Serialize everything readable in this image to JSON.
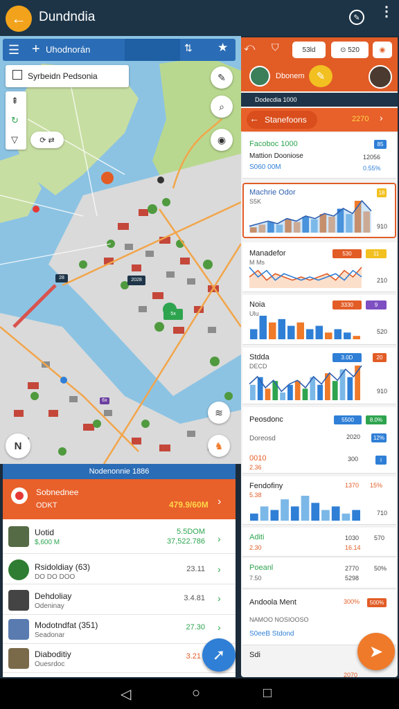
{
  "app": {
    "title": "Dundndia"
  },
  "map": {
    "toolbar_label": "Uhodnorán",
    "search_text": "Syrbeidn Pedsonia",
    "route_chip": "⟳ ⇄",
    "compass": "N",
    "markers": [
      "28",
      "2028",
      "5x",
      "6x"
    ]
  },
  "list": {
    "header": "Nodenonnie 1886",
    "hero": {
      "title": "Sobnednee",
      "sub": "ODKT",
      "value": "479.9/60M"
    },
    "rows": [
      {
        "name": "Uotid",
        "sub": "$,600 M",
        "value": "5.5DOM",
        "value2": "37,522.786",
        "accent": "#2ea44f"
      },
      {
        "name": "Rsidoldiay (63)",
        "sub": "DO DO DOO",
        "value": "23.11",
        "value2": "",
        "accent": "#555"
      },
      {
        "name": "Dehdoliay",
        "sub": "Odeninay",
        "value": "3.4.81",
        "value2": "",
        "accent": "#555"
      },
      {
        "name": "Modotndfat (351)",
        "sub": "Seadonar",
        "value": "27.30",
        "value2": "",
        "accent": "#2ea44f"
      },
      {
        "name": "Diaboditiy",
        "sub": "Ouesrdoc",
        "value": "3.21",
        "value2": "",
        "accent": "#e25c26"
      }
    ]
  },
  "right": {
    "pill1": "53ld",
    "pill2": "⊙ 520",
    "username": "Dbonem",
    "darkbar": "Dodecdia 1000",
    "nav_label": "Stanefoons",
    "nav_value": "2270",
    "cards": [
      {
        "title": "Facoboc 1000",
        "line1": "Mattion Dooniose",
        "line2": "S060 00M",
        "v1": "12056",
        "v2": "0.55%",
        "badge": "85",
        "badge_color": "#2f7fd6"
      },
      {
        "title": "Machrie Odor",
        "sub": "S5K",
        "badge": "18",
        "badge_color": "#f2c021",
        "v": "910"
      },
      {
        "title": "Manadefor",
        "sub": "M Ms",
        "badge": "530",
        "badge2": "11",
        "badge_color": "#e25c26",
        "badge2_color": "#f2c021",
        "v": "210"
      },
      {
        "title": "Noia",
        "sub": "Ulu",
        "badge": "3330",
        "badge2": "9",
        "badge_color": "#e25c26",
        "badge2_color": "#7d4fc2",
        "v": "520"
      },
      {
        "title": "Stdda",
        "sub": "DECD",
        "badge": "3.0D",
        "badge2": "20",
        "badge_color": "#2f7fd6",
        "badge2_color": "#e25c26",
        "v": "910"
      },
      {
        "title": "Peosdonc",
        "sub": "Doreosd",
        "sub2": "0010",
        "sub3": "2.36",
        "badge": "5500",
        "badge2": "8.0%",
        "badge_color": "#2f7fd6",
        "badge2_color": "#2ea44f",
        "v1": "300",
        "v2": "2020",
        "v3": "12%"
      },
      {
        "title": "Fendofiny",
        "sub": "5.38",
        "badge": "1370",
        "badge2": "15%",
        "v": "710"
      },
      {
        "title": "Aditi",
        "sub": "2.30",
        "v1": "1030",
        "v2": "16.14",
        "v3": "570"
      },
      {
        "title": "Poeanl",
        "sub": "7.50",
        "v1": "2770",
        "v2": "5298",
        "v3": "50%"
      },
      {
        "title": "Andoola Ment",
        "line1": "NAMOO NOSIOOSO",
        "line2": "S0eeB Stdond",
        "badge": "500%",
        "v1": "300%"
      },
      {
        "title": "Sdi",
        "v1": "2070"
      }
    ]
  },
  "chart_data": [
    {
      "type": "line",
      "title": "Machrie Odor",
      "series": [
        {
          "values": [
            2,
            3,
            4,
            3,
            5,
            4,
            6,
            5,
            7,
            6,
            9,
            7,
            12,
            8
          ]
        }
      ]
    },
    {
      "type": "line",
      "title": "Manadefor",
      "series": [
        {
          "values": [
            3,
            5,
            2,
            4,
            3,
            2,
            3,
            2,
            3,
            4,
            2,
            5,
            3,
            6
          ]
        }
      ]
    },
    {
      "type": "bar",
      "title": "Noia",
      "values": [
        3,
        7,
        5,
        6,
        4,
        5,
        3,
        4,
        2,
        3,
        2,
        1
      ]
    },
    {
      "type": "bar",
      "title": "Stdda",
      "values": [
        4,
        6,
        3,
        5,
        2,
        4,
        5,
        3,
        6,
        4,
        7,
        5,
        8,
        6,
        9
      ]
    },
    {
      "type": "bar",
      "title": "Fendofiny",
      "values": [
        2,
        4,
        3,
        6,
        4,
        7,
        5,
        3,
        4,
        2,
        3
      ]
    }
  ],
  "system_nav": {
    "back": "◁",
    "home": "○",
    "recents": "□"
  }
}
